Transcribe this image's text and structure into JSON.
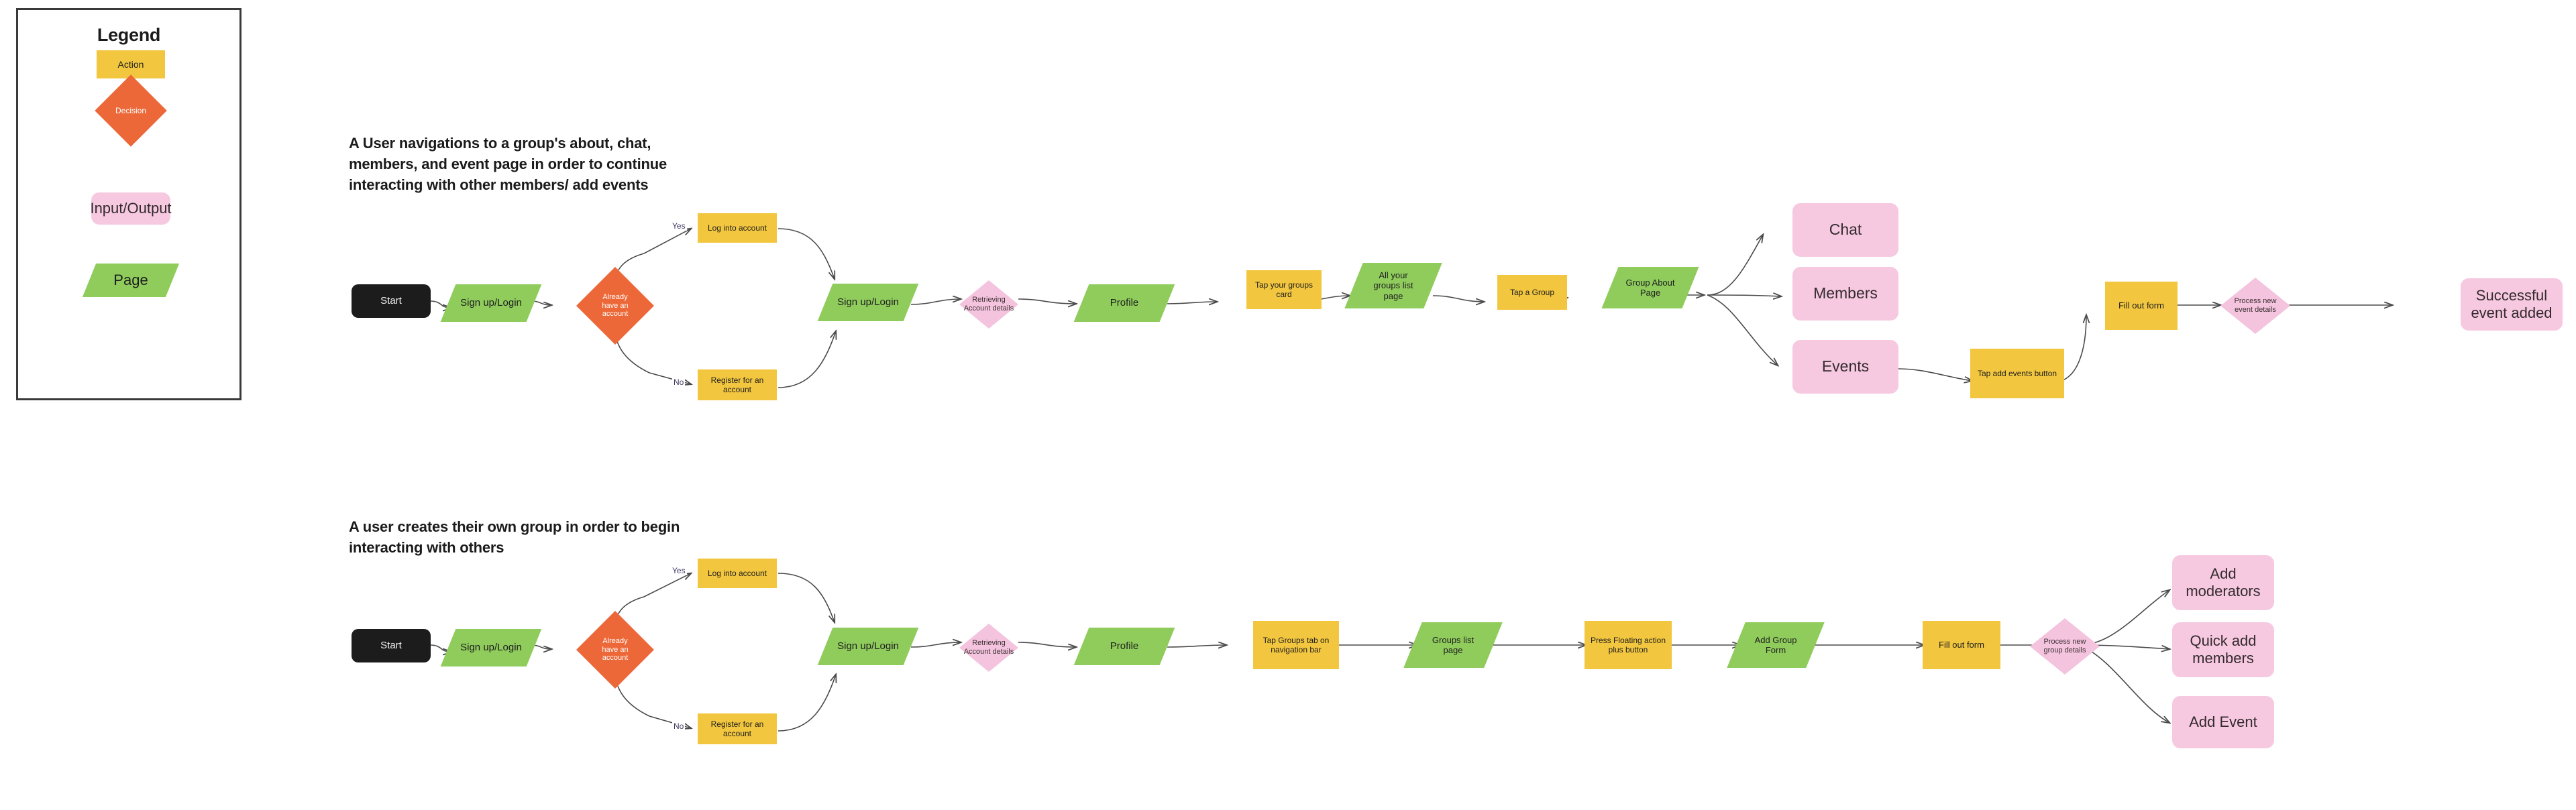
{
  "legend": {
    "title": "Legend",
    "items": [
      {
        "key": "action",
        "label": "Action",
        "shape": "rectangle",
        "color": "#f2c63f"
      },
      {
        "key": "decision",
        "label": "Decision",
        "shape": "diamond",
        "color": "#ec6839"
      },
      {
        "key": "io",
        "label": "Input/Output",
        "shape": "rounded-rect",
        "color": "#f6c9e0"
      },
      {
        "key": "page",
        "label": "Page",
        "shape": "parallelogram",
        "color": "#8fcc5c"
      }
    ]
  },
  "colors": {
    "action": "#f2c63f",
    "decision": "#ec6839",
    "io": "#f6c9e0",
    "page": "#8fcc5c",
    "start": "#1c1c1c",
    "edge": "#4a4a4a",
    "edge_label": "#3c3960",
    "background": "#ffffff",
    "legend_border": "#3a3a3a"
  },
  "flows": [
    {
      "id": "flow-1",
      "title": "A User navigations to a group's about, chat,\nmembers, and event page in order to continue\ninteracting with other members/ add events",
      "edge_labels": {
        "yes": "Yes",
        "no": "No"
      },
      "nodes": [
        {
          "id": "f1-start",
          "label": "Start",
          "type": "start"
        },
        {
          "id": "f1-signup1",
          "label": "Sign up/Login",
          "type": "page"
        },
        {
          "id": "f1-decision",
          "label": "Already\nhave an\naccount",
          "type": "decision"
        },
        {
          "id": "f1-login",
          "label": "Log into account",
          "type": "action"
        },
        {
          "id": "f1-register",
          "label": "Register for an\naccount",
          "type": "action"
        },
        {
          "id": "f1-signup2",
          "label": "Sign up/Login",
          "type": "page"
        },
        {
          "id": "f1-retrieving",
          "label": "Retrieving\nAccount details",
          "type": "io-decision"
        },
        {
          "id": "f1-profile",
          "label": "Profile",
          "type": "page"
        },
        {
          "id": "f1-tapgroups",
          "label": "Tap your groups\ncard",
          "type": "action"
        },
        {
          "id": "f1-allgroups",
          "label": "All your\ngroups list\npage",
          "type": "page"
        },
        {
          "id": "f1-tapagroup",
          "label": "Tap a Group",
          "type": "action"
        },
        {
          "id": "f1-groupabout",
          "label": "Group About\nPage",
          "type": "page"
        },
        {
          "id": "f1-chat",
          "label": "Chat",
          "type": "io"
        },
        {
          "id": "f1-members",
          "label": "Members",
          "type": "io"
        },
        {
          "id": "f1-events",
          "label": "Events",
          "type": "io"
        },
        {
          "id": "f1-tapaddevents",
          "label": "Tap add events button",
          "type": "action"
        },
        {
          "id": "f1-fillform",
          "label": "Fill out form",
          "type": "action"
        },
        {
          "id": "f1-processevent",
          "label": "Process new\nevent details",
          "type": "io-decision"
        },
        {
          "id": "f1-success",
          "label": "Successful\nevent added",
          "type": "io"
        }
      ]
    },
    {
      "id": "flow-2",
      "title": "A user creates their own group in order to begin\ninteracting with others",
      "edge_labels": {
        "yes": "Yes",
        "no": "No"
      },
      "nodes": [
        {
          "id": "f2-start",
          "label": "Start",
          "type": "start"
        },
        {
          "id": "f2-signup1",
          "label": "Sign up/Login",
          "type": "page"
        },
        {
          "id": "f2-decision",
          "label": "Already\nhave an\naccount",
          "type": "decision"
        },
        {
          "id": "f2-login",
          "label": "Log into account",
          "type": "action"
        },
        {
          "id": "f2-register",
          "label": "Register for an\naccount",
          "type": "action"
        },
        {
          "id": "f2-signup2",
          "label": "Sign up/Login",
          "type": "page"
        },
        {
          "id": "f2-retrieving",
          "label": "Retrieving\nAccount details",
          "type": "io-decision"
        },
        {
          "id": "f2-profile",
          "label": "Profile",
          "type": "page"
        },
        {
          "id": "f2-tapgroupstab",
          "label": "Tap Groups tab on\nnavigation bar",
          "type": "action"
        },
        {
          "id": "f2-groupslist",
          "label": "Groups list\npage",
          "type": "page"
        },
        {
          "id": "f2-fab",
          "label": "Press Floating action\nplus button",
          "type": "action"
        },
        {
          "id": "f2-addgroupform",
          "label": "Add Group\nForm",
          "type": "page"
        },
        {
          "id": "f2-fillform",
          "label": "Fill out form",
          "type": "action"
        },
        {
          "id": "f2-processgroup",
          "label": "Process new\ngroup details",
          "type": "io-decision"
        },
        {
          "id": "f2-addmods",
          "label": "Add\nmoderators",
          "type": "io"
        },
        {
          "id": "f2-quickadd",
          "label": "Quick add\nmembers",
          "type": "io"
        },
        {
          "id": "f2-addevent",
          "label": "Add Event",
          "type": "io"
        }
      ]
    }
  ]
}
